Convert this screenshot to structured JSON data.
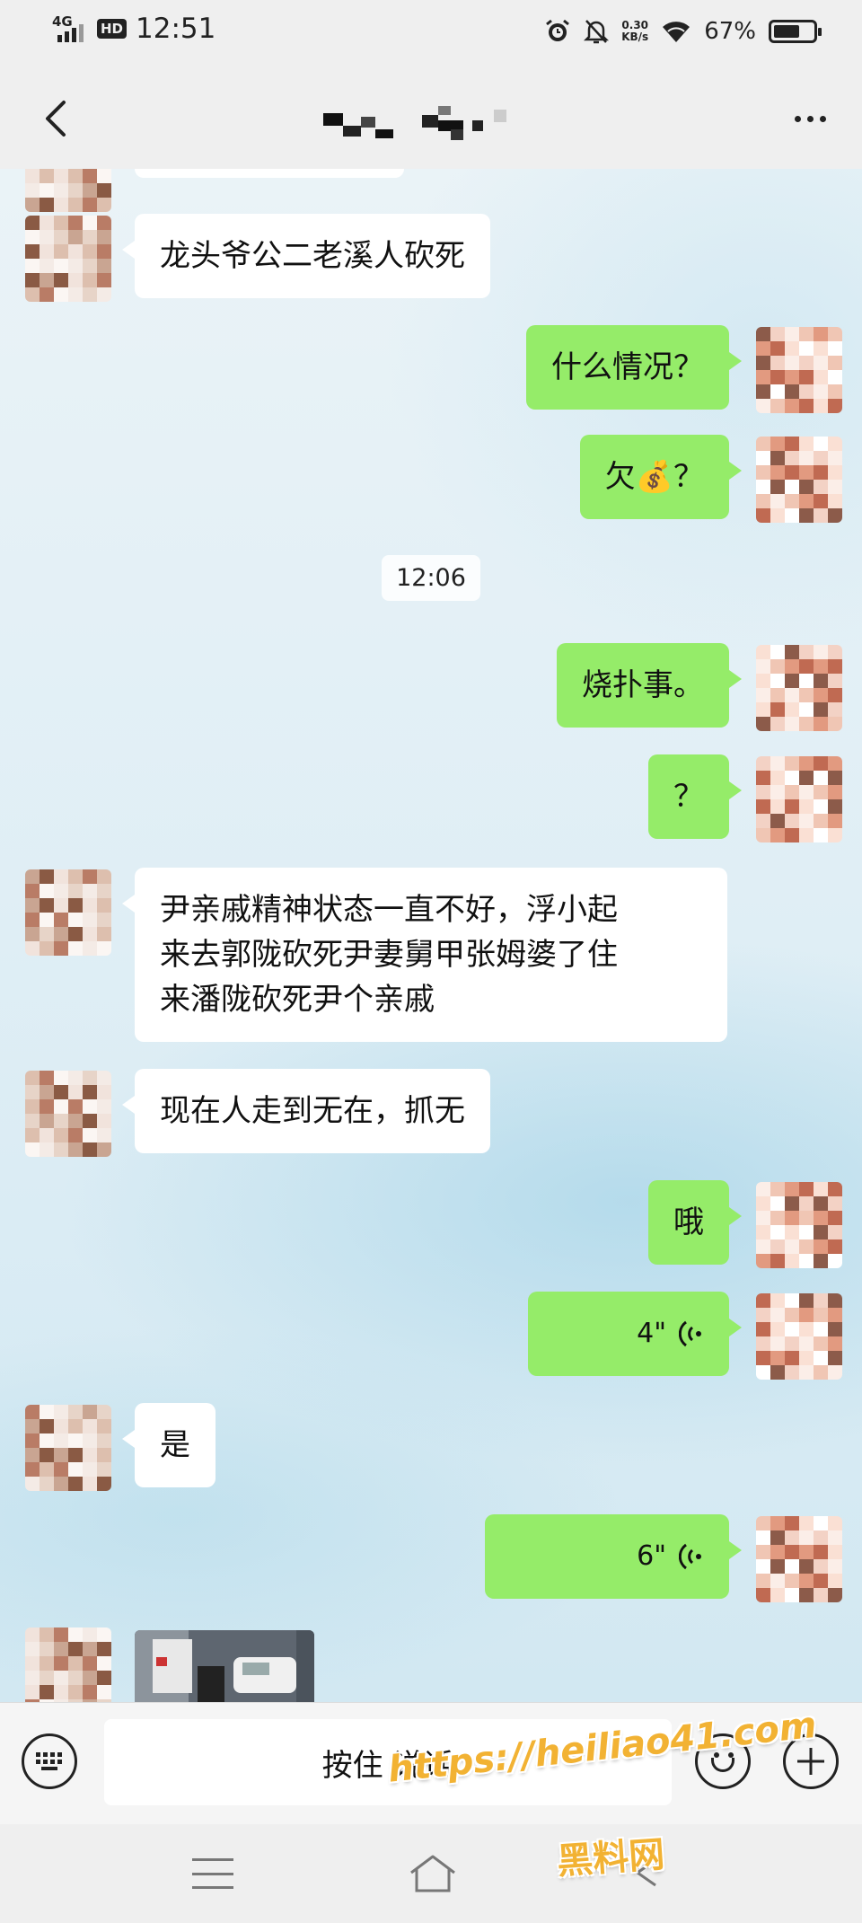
{
  "status_bar": {
    "network": "4G",
    "hd": "HD",
    "time": "12:51",
    "speed_value": "0.30",
    "speed_unit": "KB/s",
    "battery_percent": "67%",
    "battery_level": 0.67
  },
  "nav": {
    "back_icon": "chevron-left-icon",
    "more_icon": "more-horizontal-icon"
  },
  "chat": {
    "messages": [
      {
        "side": "in",
        "text": "龙头爷公二老溪人砍死"
      },
      {
        "side": "out",
        "text": "什么情况？"
      },
      {
        "side": "out",
        "text": "欠💰？"
      },
      {
        "type": "time",
        "text": "12:06"
      },
      {
        "side": "out",
        "text": "烧扑事。"
      },
      {
        "side": "out",
        "text": "？"
      },
      {
        "side": "in",
        "text": "尹亲戚精神状态一直不好，浮小起\n来去郭陇砍死尹妻舅甲张姆婆了住\n来潘陇砍死尹个亲戚"
      },
      {
        "side": "in",
        "text": "现在人走到无在，抓无"
      },
      {
        "side": "out",
        "text": "哦"
      },
      {
        "side": "out",
        "type": "voice",
        "duration": "4\""
      },
      {
        "side": "in",
        "text": "是"
      },
      {
        "side": "out",
        "type": "voice",
        "duration": "6\""
      },
      {
        "side": "in",
        "type": "image"
      }
    ]
  },
  "input_bar": {
    "hold_to_talk": "按住 说话",
    "keyboard_icon": "keyboard-icon",
    "emoji_icon": "emoji-icon",
    "plus_icon": "plus-icon"
  },
  "watermark": {
    "url": "https://heiliao41.com",
    "name": "黑料网"
  },
  "colors": {
    "outgoing_bubble": "#95ec69",
    "incoming_bubble": "#ffffff",
    "watermark": "#f2b233"
  }
}
